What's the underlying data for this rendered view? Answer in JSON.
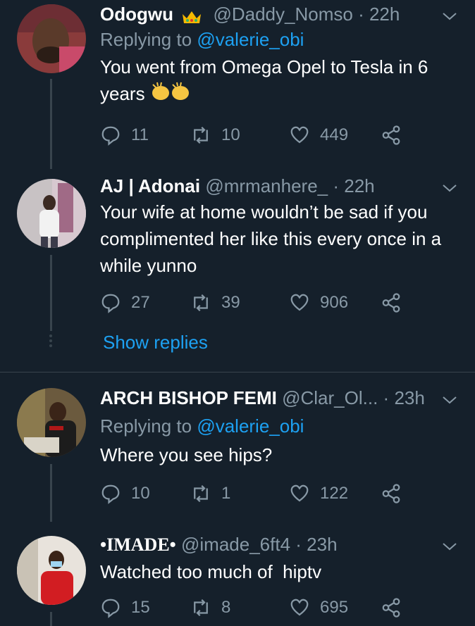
{
  "tweets": [
    {
      "name": "Odogwu",
      "handle": "@Daddy_Nomso",
      "time": "22h",
      "replying_label": "Replying to",
      "replying_to": "@valerie_obi",
      "text": "You went from Omega Opel to Tesla in 6 years",
      "reply_count": "11",
      "retweet_count": "10",
      "like_count": "449"
    },
    {
      "name": "AJ | Adonai",
      "handle": "@mrmanhere_",
      "time": "22h",
      "text": "Your wife at home wouldn’t be sad if you complimented her like this every once in a while yunno",
      "reply_count": "27",
      "retweet_count": "39",
      "like_count": "906"
    },
    {
      "name": "ARCH BISHOP FEMI",
      "handle": "@Clar_Ol...",
      "time": "23h",
      "replying_label": "Replying to",
      "replying_to": "@valerie_obi",
      "text": "Where you see hips?",
      "reply_count": "10",
      "retweet_count": "1",
      "like_count": "122"
    },
    {
      "name": "•IMADE•",
      "handle": "@imade_6ft4",
      "time": "23h",
      "text": "Watched too much of  hiptv",
      "reply_count": "15",
      "retweet_count": "8",
      "like_count": "695"
    }
  ],
  "show_replies": "Show replies",
  "colors": {
    "background": "#15202b",
    "secondary_text": "#8899a6",
    "link": "#1da1f2",
    "divider": "#38444d"
  },
  "icons": [
    "crown-emoji",
    "clapping-hands-emoji",
    "reply-icon",
    "retweet-icon",
    "like-icon",
    "share-icon",
    "chevron-down-icon"
  ]
}
